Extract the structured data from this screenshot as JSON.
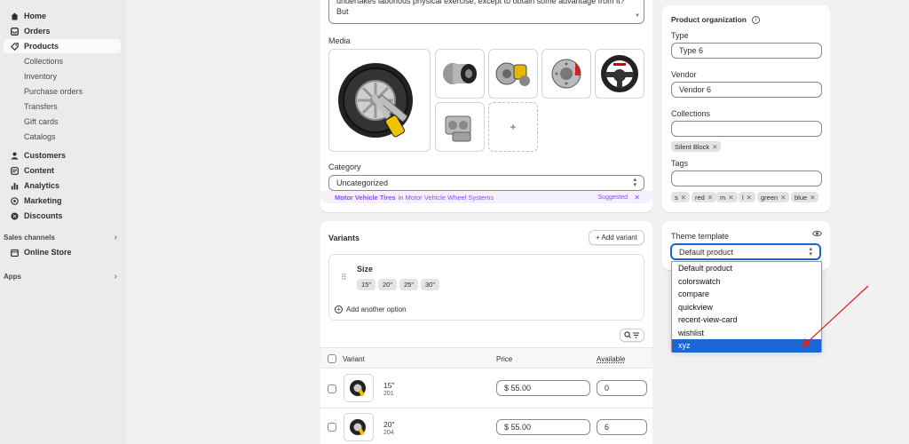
{
  "sidebar": {
    "main_items": [
      {
        "label": "Home",
        "icon": "home-icon"
      },
      {
        "label": "Orders",
        "icon": "inbox-icon"
      },
      {
        "label": "Products",
        "icon": "tag-icon"
      }
    ],
    "product_subitems": [
      "Collections",
      "Inventory",
      "Purchase orders",
      "Transfers",
      "Gift cards",
      "Catalogs"
    ],
    "more_items": [
      {
        "label": "Customers",
        "icon": "person-icon"
      },
      {
        "label": "Content",
        "icon": "content-icon"
      },
      {
        "label": "Analytics",
        "icon": "bar-chart-icon"
      },
      {
        "label": "Marketing",
        "icon": "target-icon"
      },
      {
        "label": "Discounts",
        "icon": "discount-icon"
      }
    ],
    "sales_channels_label": "Sales channels",
    "online_store": "Online Store",
    "apps_label": "Apps"
  },
  "description": {
    "text": "can procure him some great pleasure. To take a trivial example, which of us ever undertakes laborious physical exercise, except to obtain some advantage from it? But"
  },
  "media": {
    "label": "Media",
    "add_symbol": "+"
  },
  "category": {
    "label": "Category",
    "value": "Uncategorized",
    "suggestion_bold": "Motor Vehicle Tires",
    "suggestion_rest": "in Motor Vehicle Wheel Systems",
    "suggested_label": "Suggested",
    "dismiss": "✕"
  },
  "variants": {
    "title": "Variants",
    "add_button": "+ Add variant",
    "option_name": "Size",
    "option_values": [
      "15\"",
      "20\"",
      "25\"",
      "30\""
    ],
    "add_option": "Add another option",
    "columns": {
      "variant": "Variant",
      "price": "Price",
      "available": "Available"
    },
    "rows": [
      {
        "name": "15\"",
        "sub": "201",
        "price": "$ 55.00",
        "available": "0"
      },
      {
        "name": "20\"",
        "sub": "204",
        "price": "$ 55.00",
        "available": "6"
      }
    ]
  },
  "organization": {
    "title": "Product organization",
    "type_label": "Type",
    "type_value": "Type 6",
    "vendor_label": "Vendor",
    "vendor_value": "Vendor 6",
    "collections_label": "Collections",
    "collection_chips": [
      "Silent Block"
    ],
    "tags_label": "Tags",
    "tag_chips": [
      "s",
      "red",
      "m",
      "l",
      "green",
      "blue"
    ]
  },
  "theme": {
    "label": "Theme template",
    "selected": "Default product",
    "options": [
      "Default product",
      "colorswatch",
      "compare",
      "quickview",
      "recent-view-card",
      "wishlist",
      "xyz"
    ],
    "highlighted": "xyz"
  },
  "colors": {
    "accent": "#1a66d2",
    "suggestion": "#8051ff",
    "arrow": "#e02020"
  }
}
